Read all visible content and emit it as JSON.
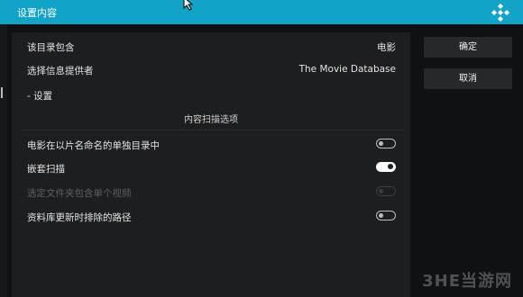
{
  "window": {
    "title": "设置内容"
  },
  "rows": {
    "dir_contains": {
      "label": "该目录包含",
      "value": "电影"
    },
    "info_provider": {
      "label": "选择信息提供者",
      "value": "The Movie Database"
    },
    "settings": {
      "label": "- 设置"
    }
  },
  "scan_section": {
    "title": "内容扫描选项",
    "options": [
      {
        "label": "电影在以片名命名的单独目录中",
        "state": "off",
        "enabled": true
      },
      {
        "label": "嵌套扫描",
        "state": "on",
        "enabled": true
      },
      {
        "label": "选定文件夹包含单个视频",
        "state": "off",
        "enabled": false
      },
      {
        "label": "资料库更新时排除的路径",
        "state": "off",
        "enabled": true
      }
    ]
  },
  "buttons": {
    "ok": "确定",
    "cancel": "取消"
  },
  "watermark": "3HE当游网",
  "colors": {
    "title_bar": "#12a3c7",
    "panel": "#1d1e20",
    "background": "#101113"
  }
}
